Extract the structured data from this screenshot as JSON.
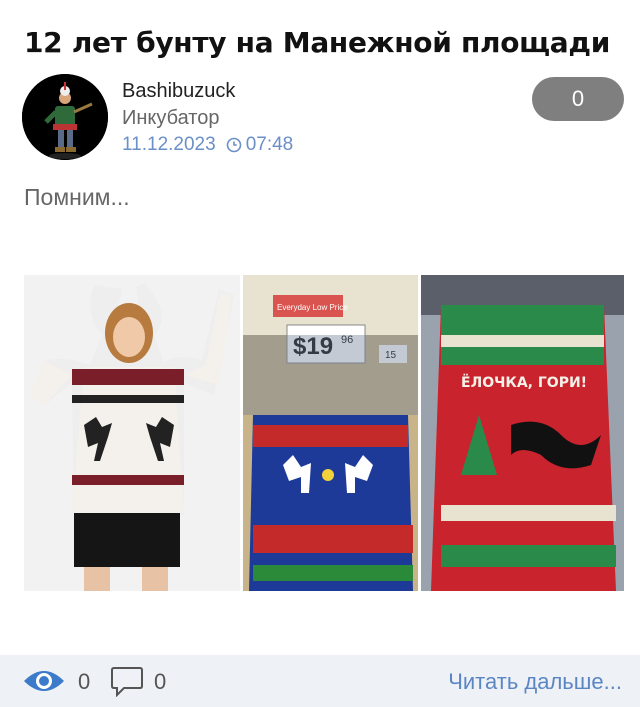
{
  "post": {
    "title": "12 лет бунту на Манежной площади",
    "author": "Bashibuzuck",
    "category": "Инкубатор",
    "date": "11.12.2023",
    "time": "07:48",
    "rating": "0",
    "text": "Помним..."
  },
  "gallery": {
    "price_tag": "$19",
    "price_cents": "96",
    "banner": "Everyday Low Price",
    "sweater_text": "ЁЛОЧКА, ГОРИ!",
    "shelf_tag": "15"
  },
  "footer": {
    "views": "0",
    "comments": "0",
    "read_more": "Читать дальше..."
  },
  "icons": {
    "views": "eye-icon",
    "comments": "speech-bubble-icon",
    "time": "clock-icon"
  },
  "colors": {
    "link": "#5b86c4",
    "date": "#6b8fc7",
    "rating_bg": "#7f7f7f",
    "footer_bg": "#eef1f6"
  }
}
